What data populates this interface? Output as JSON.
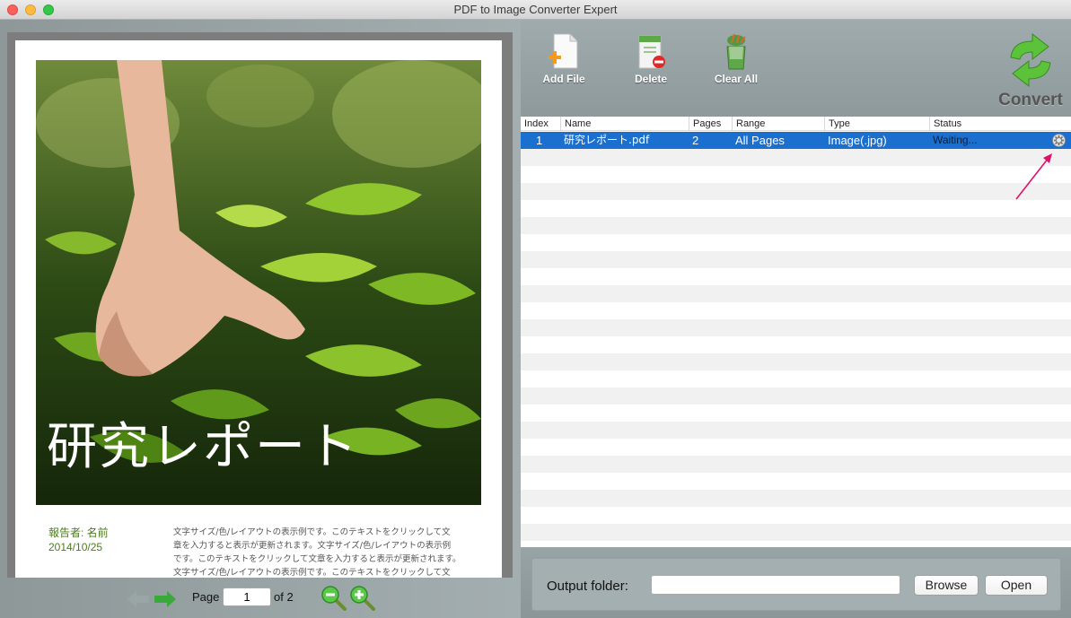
{
  "window": {
    "title": "PDF to Image Converter Expert"
  },
  "preview": {
    "cover_title": "研究レポート",
    "reporter": "報告者: 名前",
    "date": "2014/10/25",
    "body_lines": [
      "文字サイズ/色/レイアウトの表示例です。このテキストをクリックして文",
      "章を入力すると表示が更新されます。文字サイズ/色/レイアウトの表示例",
      "です。このテキストをクリックして文章を入力すると表示が更新されます。",
      "文字サイズ/色/レイアウトの表示例です。このテキストをクリックして文"
    ]
  },
  "pager": {
    "page_label": "Page",
    "page_value": "1",
    "of_label": "of 2"
  },
  "toolbar": {
    "add_file": "Add File",
    "delete": "Delete",
    "clear_all": "Clear All",
    "convert": "Convert"
  },
  "table": {
    "headers": {
      "index": "Index",
      "name": "Name",
      "pages": "Pages",
      "range": "Range",
      "type": "Type",
      "status": "Status"
    },
    "rows": [
      {
        "index": "1",
        "name": "研究レポート.pdf",
        "pages": "2",
        "range": "All Pages",
        "type": "Image(.jpg)",
        "status": "Waiting..."
      }
    ]
  },
  "output": {
    "label": "Output folder:",
    "value": "",
    "browse": "Browse",
    "open": "Open"
  },
  "colors": {
    "selection": "#1b6fce",
    "annotation_arrow": "#e0116a",
    "arrow_green": "#3aa83a"
  },
  "icons": [
    "add-file-icon",
    "delete-icon",
    "clear-all-icon",
    "convert-icon",
    "gear-icon",
    "prev-page-icon",
    "next-page-icon",
    "zoom-out-icon",
    "zoom-in-icon"
  ]
}
